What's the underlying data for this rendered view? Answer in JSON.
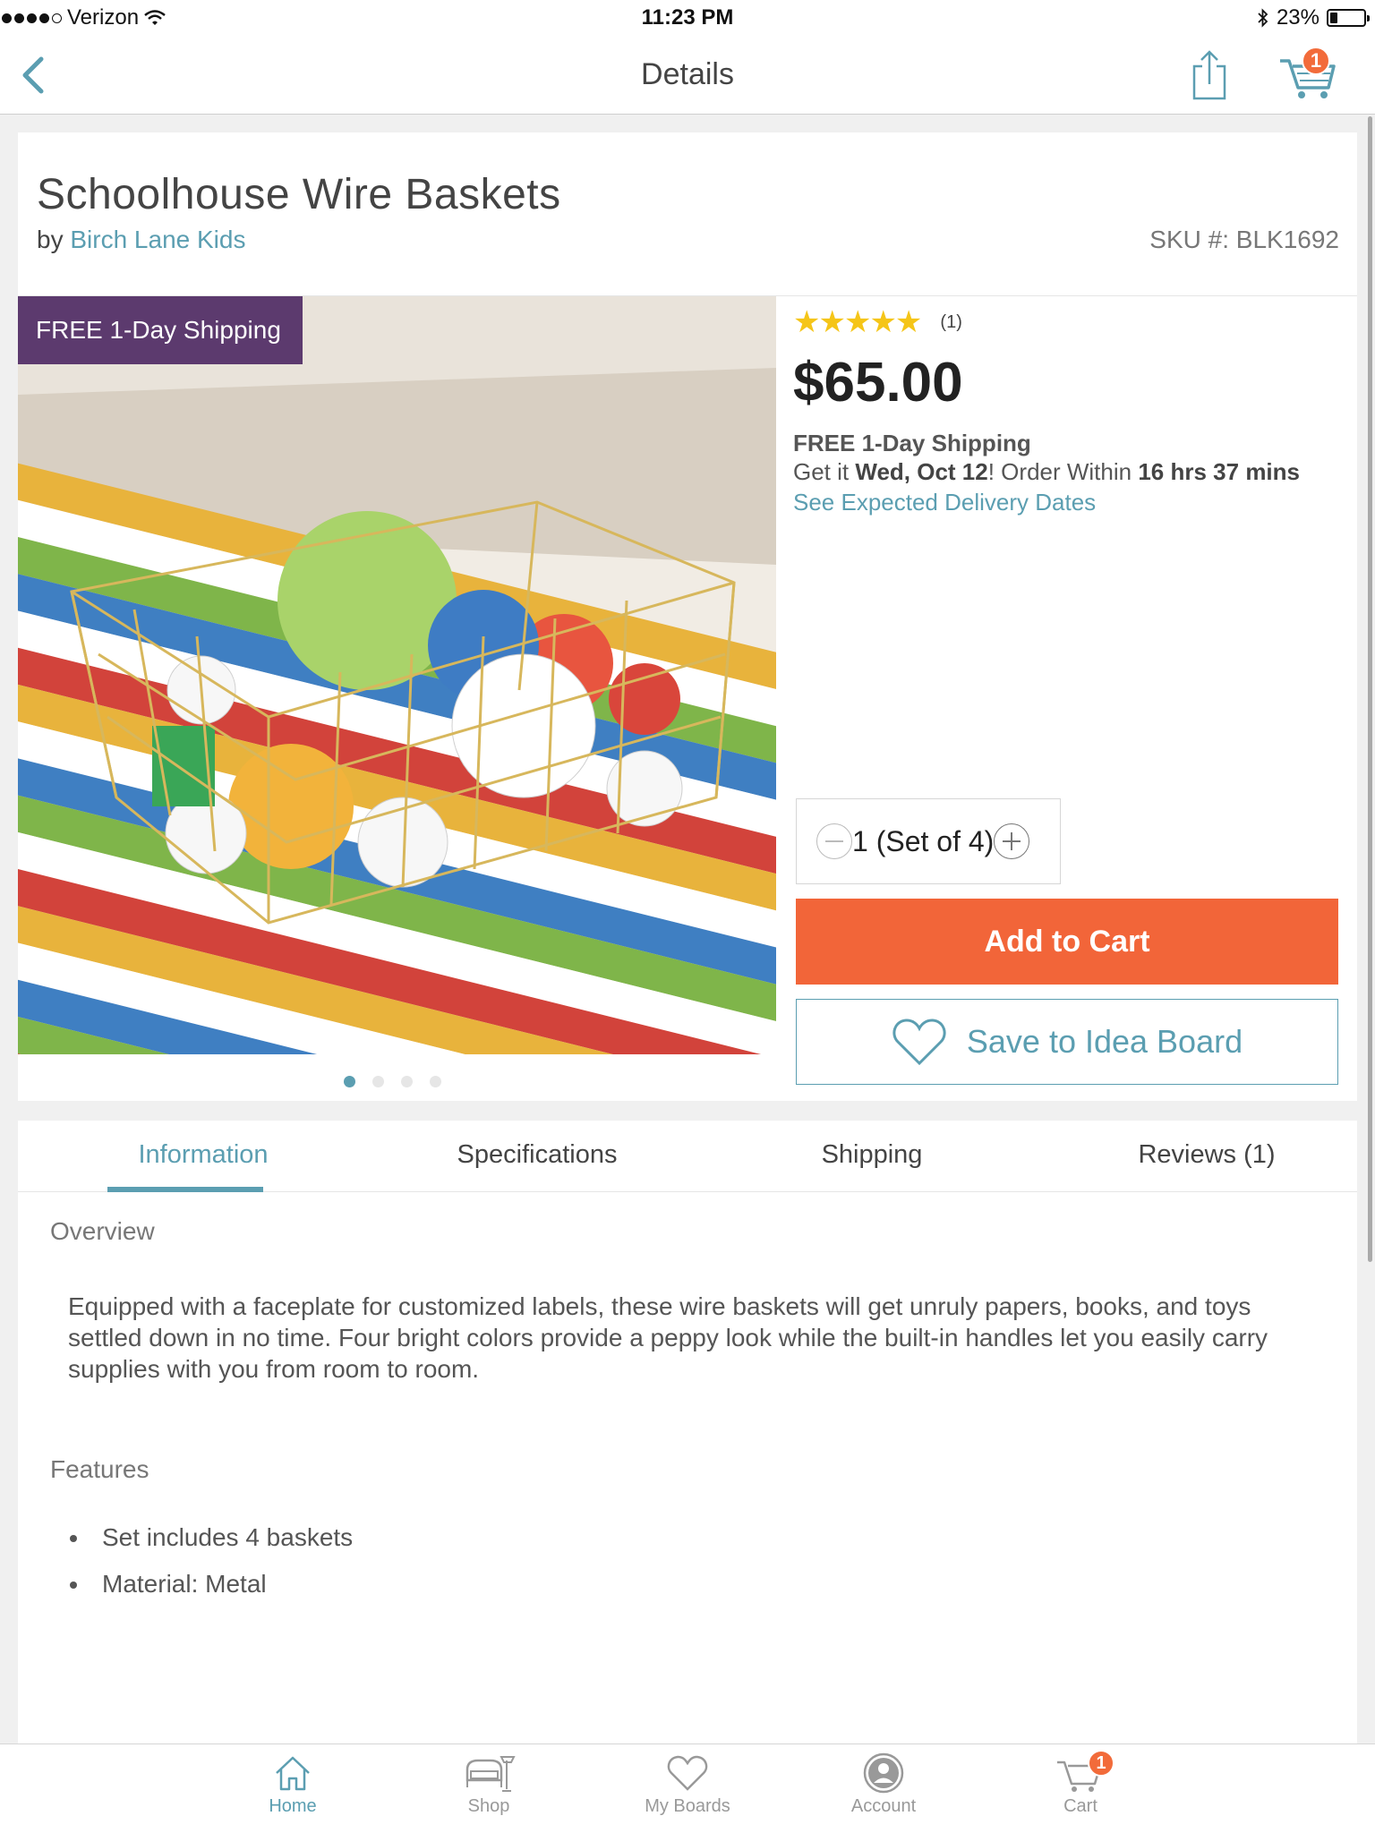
{
  "status_bar": {
    "carrier": "Verizon",
    "time": "11:23 PM",
    "battery": "23%",
    "battery_level": 0.23
  },
  "nav": {
    "title": "Details",
    "cart_count": "1"
  },
  "product": {
    "title": "Schoolhouse Wire Baskets",
    "by": "by",
    "brand": "Birch Lane Kids",
    "sku": "SKU #: BLK1692",
    "image_badge": "FREE 1-Day Shipping",
    "rating_stars": 5,
    "rating_count": "(1)",
    "price": "$65.00",
    "shipping": "FREE 1-Day Shipping",
    "delivery_prefix": "Get it",
    "delivery_date": "Wed, Oct 12",
    "delivery_middle": "! Order Within",
    "delivery_countdown": "16 hrs 37 mins",
    "delivery_link": "See Expected Delivery Dates",
    "quantity": "1 (Set of 4)",
    "add_to_cart": "Add to Cart",
    "save_to_board": "Save to Idea Board",
    "image_page": 1,
    "image_pages": 4
  },
  "tabs": [
    "Information",
    "Specifications",
    "Shipping",
    "Reviews (1)"
  ],
  "active_tab": "Information",
  "overview": {
    "heading": "Overview",
    "text": "Equipped with a faceplate for customized labels, these wire baskets will get unruly papers, books, and toys settled down in no time. Four bright colors provide a peppy look while the built-in handles let you easily carry supplies with you from room to room."
  },
  "features": {
    "heading": "Features",
    "items": [
      "Set includes 4 baskets",
      "Material: Metal"
    ]
  },
  "tab_bar": {
    "items": [
      {
        "label": "Home",
        "icon": "home-icon"
      },
      {
        "label": "Shop",
        "icon": "shop-icon"
      },
      {
        "label": "My Boards",
        "icon": "heart-icon"
      },
      {
        "label": "Account",
        "icon": "account-icon"
      },
      {
        "label": "Cart",
        "icon": "cart-icon"
      }
    ],
    "cart_count": "1",
    "active": "Home"
  },
  "colors": {
    "accent": "#5b9eb1",
    "cta": "#f26539",
    "badge_purple": "#5c3a6e",
    "star": "#f5c518"
  }
}
